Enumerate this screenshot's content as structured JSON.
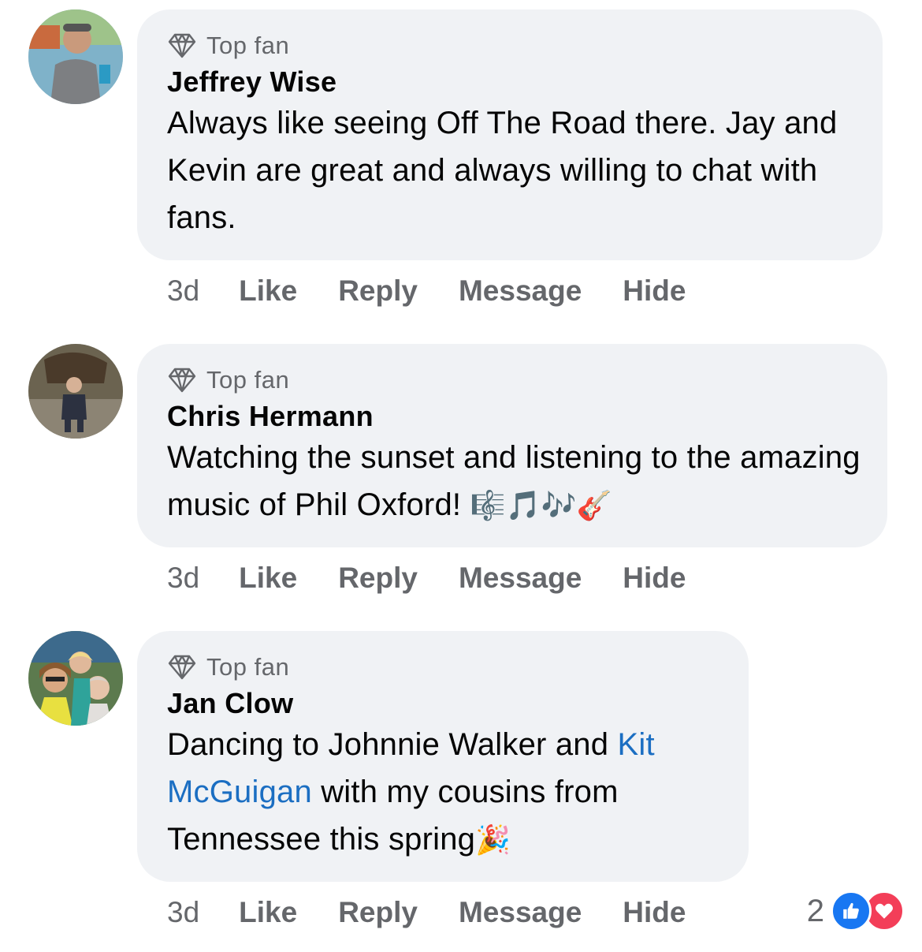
{
  "comments": [
    {
      "badge": "Top fan",
      "author": "Jeffrey Wise",
      "text": "Always like seeing Off The Road there. Jay and Kevin are great and always willing to chat with fans.",
      "time": "3d"
    },
    {
      "badge": "Top fan",
      "author": "Chris Hermann",
      "text": "Watching the sunset and listening to the amazing music of Phil Oxford!",
      "emoji": "🎼🎵🎶🎸",
      "time": "3d"
    },
    {
      "badge": "Top fan",
      "author": "Jan Clow",
      "text_before": "Dancing to Johnnie Walker and ",
      "mention": "Kit McGuigan",
      "text_after": " with my cousins from Tennessee this spring",
      "emoji": "🎉",
      "time": "3d",
      "reaction_count": "2",
      "reaction_icons": [
        "like-icon",
        "love-icon"
      ]
    }
  ],
  "actions": {
    "like": "Like",
    "reply": "Reply",
    "message": "Message",
    "hide": "Hide"
  },
  "colors": {
    "bubble": "#f0f2f5",
    "secondary_text": "#65676b",
    "mention": "#1b6ec2",
    "like": "#1877f2",
    "love": "#f33e58"
  }
}
